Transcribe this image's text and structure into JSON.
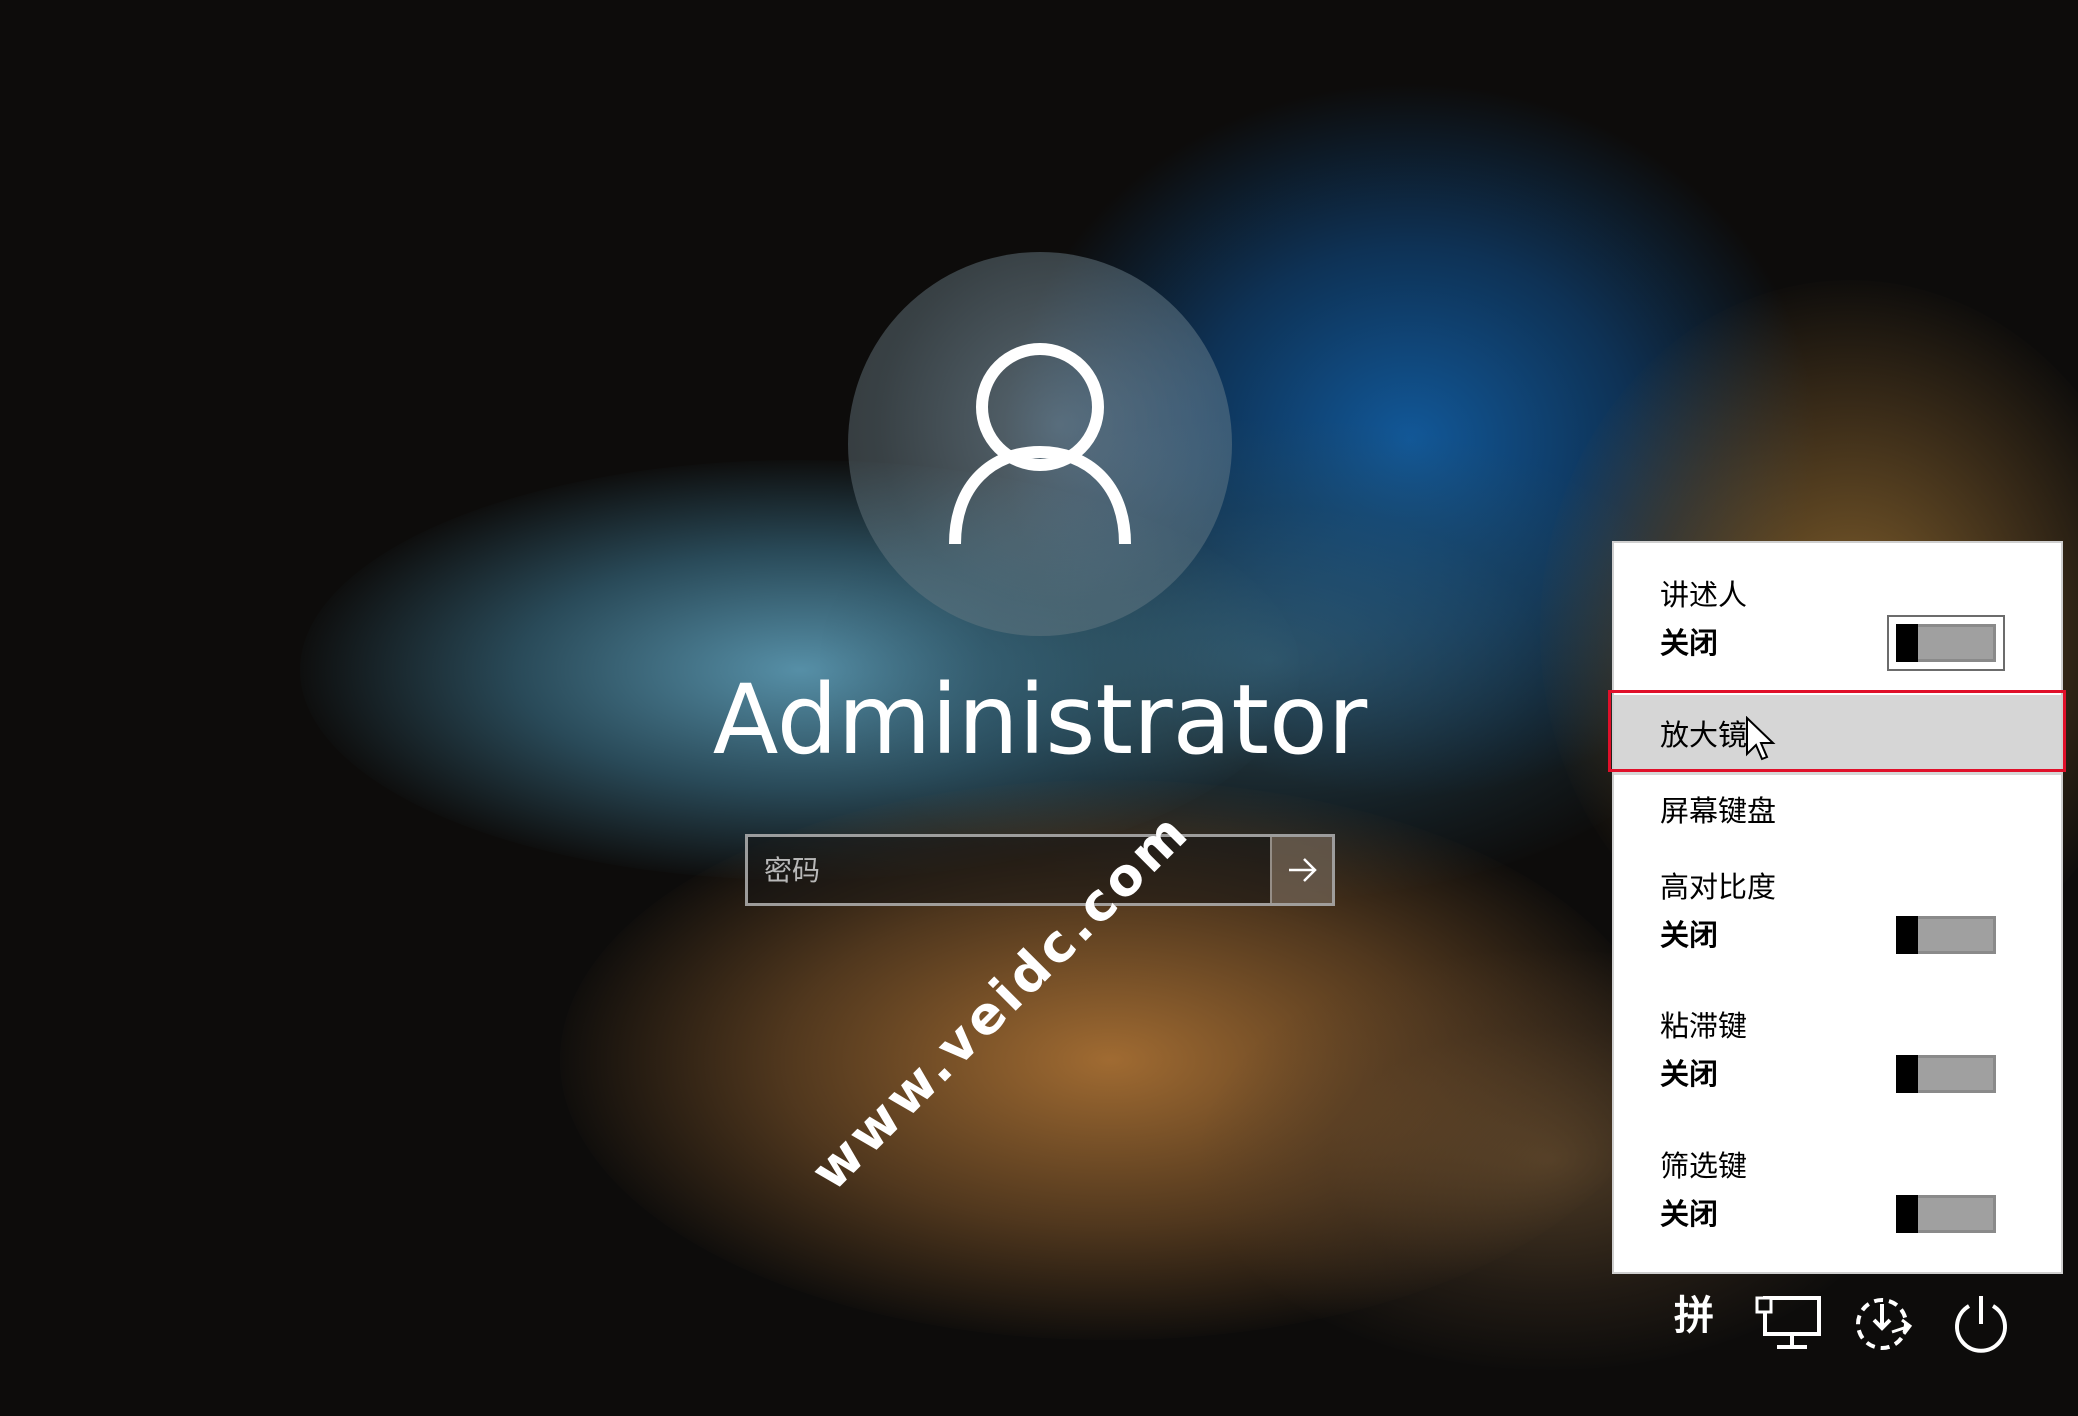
{
  "user": {
    "name": "Administrator"
  },
  "password": {
    "placeholder": "密码",
    "value": ""
  },
  "watermark": "www.veidc.com",
  "ease_of_access_menu": {
    "items": [
      {
        "label": "讲述人",
        "state": "关闭",
        "toggle_on": false
      },
      {
        "label": "放大镜"
      },
      {
        "label": "屏幕键盘"
      },
      {
        "label": "高对比度",
        "state": "关闭",
        "toggle_on": false
      },
      {
        "label": "粘滞键",
        "state": "关闭",
        "toggle_on": false
      },
      {
        "label": "筛选键",
        "state": "关闭",
        "toggle_on": false
      }
    ]
  },
  "taskbar": {
    "ime_label": "拼",
    "icons": [
      "ime-indicator",
      "network-icon",
      "ease-of-access-icon",
      "power-icon"
    ]
  },
  "colors": {
    "highlight_border": "#e0102a",
    "menu_background": "#ffffff",
    "hover_background": "#d6d6d6"
  }
}
